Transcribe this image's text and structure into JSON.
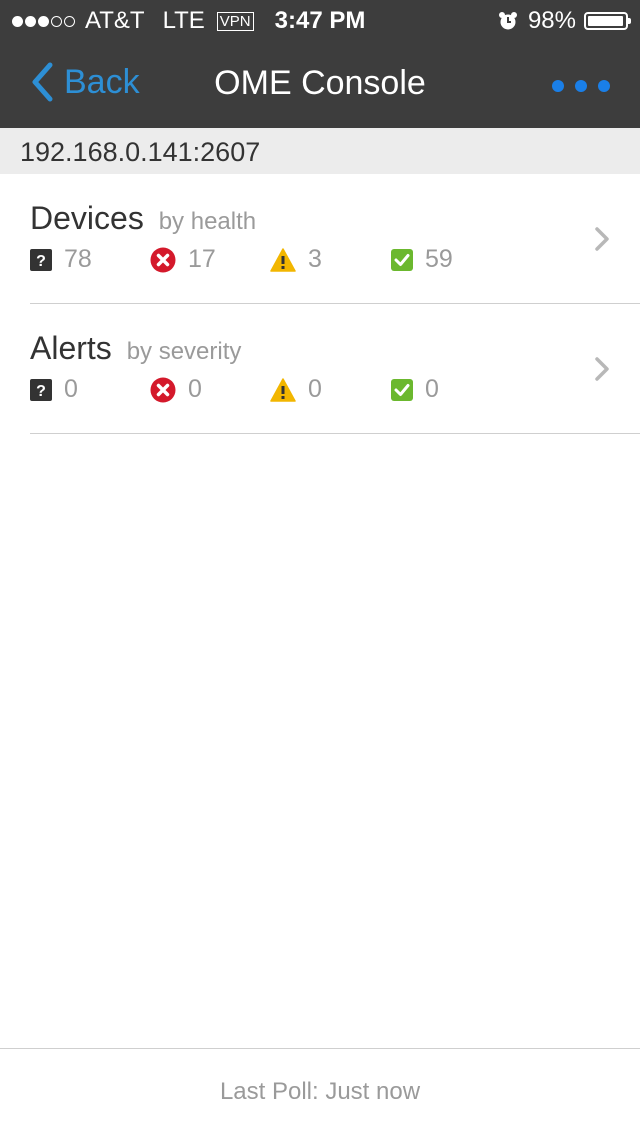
{
  "status_bar": {
    "signal_bars_filled": 3,
    "signal_bars_total": 5,
    "carrier": "AT&T",
    "network": "LTE",
    "vpn": "VPN",
    "time": "3:47 PM",
    "alarm_icon": "alarm-clock-icon",
    "battery_percent": "98%",
    "battery_level": 0.98
  },
  "nav": {
    "back_label": "Back",
    "title": "OME Console",
    "more_icon": "ellipsis-icon"
  },
  "host": "192.168.0.141:2607",
  "devices": {
    "title": "Devices",
    "subtitle": "by health",
    "unknown": "78",
    "critical": "17",
    "warning": "3",
    "normal": "59"
  },
  "alerts": {
    "title": "Alerts",
    "subtitle": "by severity",
    "unknown": "0",
    "critical": "0",
    "warning": "0",
    "normal": "0"
  },
  "footer": {
    "last_poll": "Last Poll: Just now"
  },
  "colors": {
    "bar_background": "#3d3d3d",
    "accent_blue": "#2d8fd5",
    "unknown": "#333333",
    "critical": "#d4192b",
    "warning": "#f2b600",
    "normal": "#6bb82e"
  }
}
